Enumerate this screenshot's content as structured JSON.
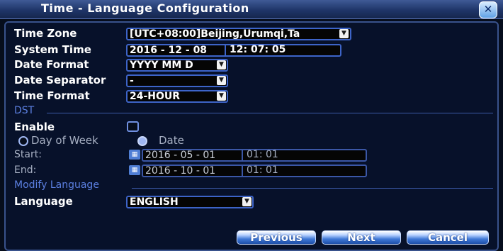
{
  "window": {
    "title": "Time - Language Configuration",
    "close_glyph": "✕"
  },
  "general": {
    "time_zone_label": "Time Zone",
    "time_zone_value": "[UTC+08:00]Beijing,Urumqi,Ta",
    "system_time_label": "System Time",
    "system_date": "2016 - 12 - 08",
    "system_clock": "12: 07: 05",
    "date_format_label": "Date Format",
    "date_format_value": "YYYY MM D",
    "date_separator_label": "Date Separator",
    "date_separator_value": "-",
    "time_format_label": "Time Format",
    "time_format_value": "24-HOUR"
  },
  "dst": {
    "section_title": "DST",
    "enable_label": "Enable",
    "enabled": false,
    "mode_day_of_week": "Day of Week",
    "mode_date": "Date",
    "selected_mode": "Date",
    "start_label": "Start:",
    "start_date": "2016 - 05 - 01",
    "start_time": "01: 01",
    "end_label": "End:",
    "end_date": "2016 - 10 - 01",
    "end_time": "01: 01"
  },
  "language": {
    "section_title": "Modify Language",
    "language_label": "Language",
    "language_value": "ENGLISH"
  },
  "buttons": {
    "previous": "Previous",
    "next": "Next",
    "cancel": "Cancel"
  },
  "icons": {
    "dropdown": "chevron-down-icon",
    "calendar": "calendar-icon",
    "close": "close-icon"
  },
  "colors": {
    "accent": "#3d64c8",
    "section": "#5b7fe0",
    "background": "#060d1c"
  }
}
